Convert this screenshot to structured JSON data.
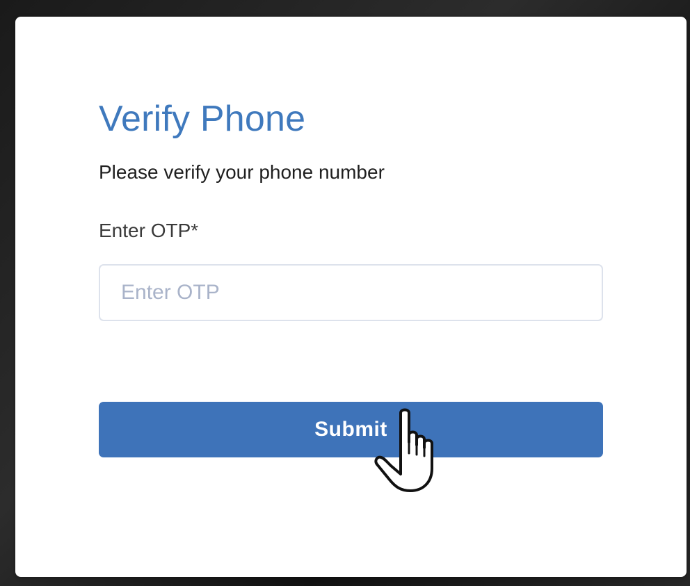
{
  "dialog": {
    "title": "Verify Phone",
    "subtitle": "Please verify your phone number",
    "otp_label": "Enter OTP*",
    "otp_placeholder": "Enter OTP",
    "otp_value": "",
    "submit_label": "Submit"
  },
  "colors": {
    "accent": "#3e73b9",
    "title": "#3f79bd",
    "input_border": "#dde2ec",
    "placeholder": "#a9b3c9"
  },
  "icons": {
    "cursor": "hand-pointer-icon"
  }
}
